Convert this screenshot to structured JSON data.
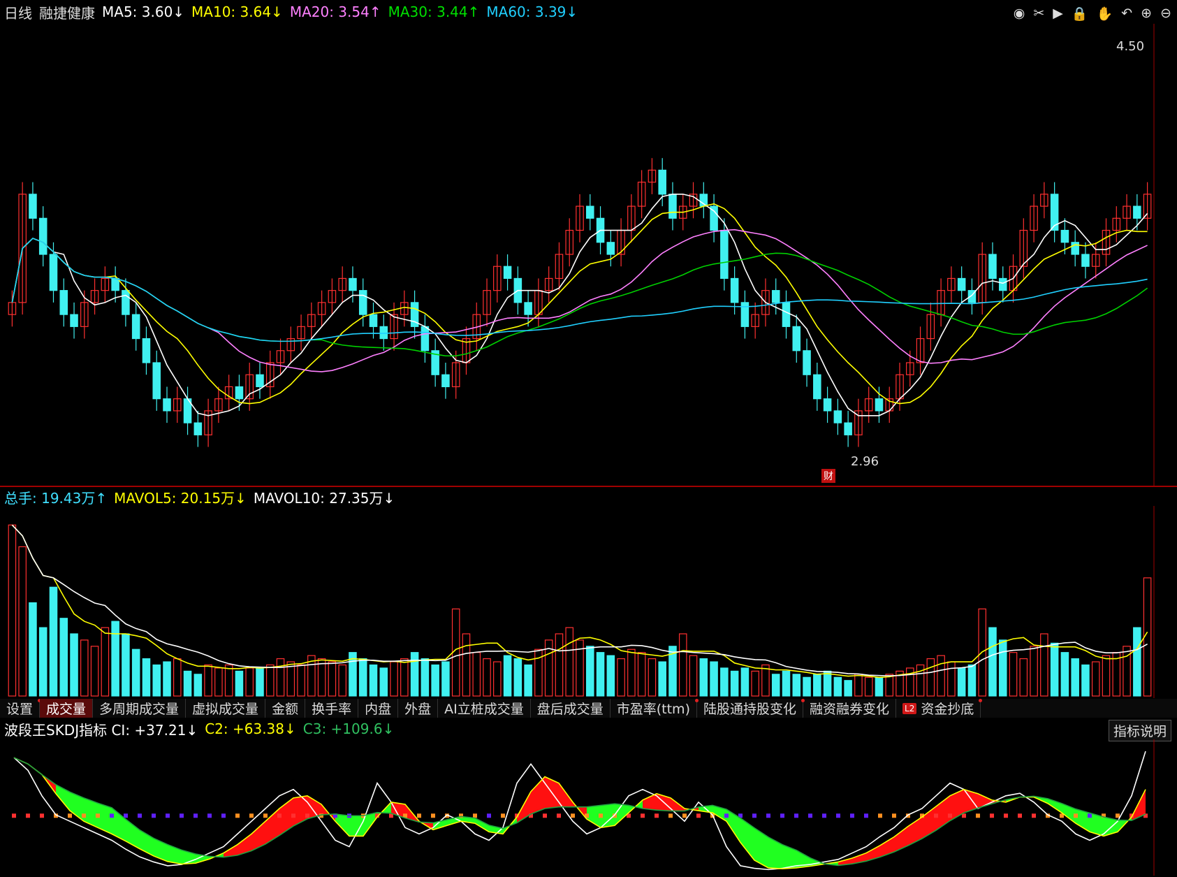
{
  "header": {
    "period": "日线",
    "name": "融捷健康",
    "ma": [
      {
        "label": "MA5: 3.60",
        "arrow": "↓",
        "color": "#ffffff"
      },
      {
        "label": "MA10: 3.64",
        "arrow": "↓",
        "color": "#ffff00"
      },
      {
        "label": "MA20: 3.54",
        "arrow": "↑",
        "color": "#ff80ff"
      },
      {
        "label": "MA30: 3.44",
        "arrow": "↑",
        "color": "#00e000"
      },
      {
        "label": "MA60: 3.39",
        "arrow": "↓",
        "color": "#20d0ff"
      }
    ]
  },
  "toolbar_icons": [
    "eye-icon",
    "scissors-icon",
    "play-icon",
    "lock-icon",
    "hand-icon",
    "undo-icon",
    "zoom-in-icon",
    "zoom-out-icon"
  ],
  "volume_header": [
    {
      "label": "总手: 19.43万",
      "arrow": "↑",
      "color": "#40e0ff"
    },
    {
      "label": "MAVOL5: 20.15万",
      "arrow": "↓",
      "color": "#ffff00"
    },
    {
      "label": "MAVOL10: 27.35万",
      "arrow": "↓",
      "color": "#ffffff"
    }
  ],
  "tabs": [
    {
      "label": "设置",
      "active": false,
      "dot": true
    },
    {
      "label": "成交量",
      "active": true,
      "dot": false
    },
    {
      "label": "多周期成交量",
      "active": false,
      "dot": false
    },
    {
      "label": "虚拟成交量",
      "active": false,
      "dot": false
    },
    {
      "label": "金额",
      "active": false,
      "dot": false
    },
    {
      "label": "换手率",
      "active": false,
      "dot": false
    },
    {
      "label": "内盘",
      "active": false,
      "dot": false
    },
    {
      "label": "外盘",
      "active": false,
      "dot": false
    },
    {
      "label": "AI立桩成交量",
      "active": false,
      "dot": false
    },
    {
      "label": "盘后成交量",
      "active": false,
      "dot": false
    },
    {
      "label": "市盈率(ttm)",
      "active": false,
      "dot": true
    },
    {
      "label": "陆股通持股变化",
      "active": false,
      "dot": true
    },
    {
      "label": "融资融券变化",
      "active": false,
      "dot": false
    },
    {
      "label": "资金抄底",
      "active": false,
      "dot": true,
      "badge": "L2"
    }
  ],
  "indicator_header": [
    {
      "label": "波段王SKDJ指标 CI: +37.21",
      "arrow": "↓",
      "color": "#ffffff"
    },
    {
      "label": "C2: +63.38",
      "arrow": "↓",
      "color": "#ffff00"
    },
    {
      "label": "C3: +109.6",
      "arrow": "↓",
      "color": "#30c060"
    }
  ],
  "explain_button": "指标说明",
  "price_marks": {
    "high_label": "4.50",
    "low_label": "2.96",
    "event_badge": "财"
  },
  "colors": {
    "up": "#ff3030",
    "down": "#40f0f0",
    "ma5": "#ffffff",
    "ma10": "#ffff00",
    "ma20": "#ff80ff",
    "ma30": "#00d000",
    "ma60": "#20d0ff"
  },
  "chart_data": {
    "type": "candlestick",
    "price_range": [
      2.8,
      4.6
    ],
    "closes": [
      3.5,
      3.95,
      3.85,
      3.7,
      3.55,
      3.45,
      3.4,
      3.5,
      3.55,
      3.6,
      3.55,
      3.45,
      3.35,
      3.25,
      3.1,
      3.05,
      3.1,
      3.0,
      2.95,
      3.05,
      3.1,
      3.15,
      3.1,
      3.2,
      3.15,
      3.25,
      3.3,
      3.35,
      3.4,
      3.45,
      3.5,
      3.55,
      3.6,
      3.55,
      3.45,
      3.4,
      3.35,
      3.45,
      3.5,
      3.4,
      3.3,
      3.2,
      3.15,
      3.25,
      3.35,
      3.45,
      3.55,
      3.65,
      3.6,
      3.5,
      3.45,
      3.55,
      3.6,
      3.7,
      3.8,
      3.9,
      3.85,
      3.75,
      3.7,
      3.8,
      3.9,
      4.0,
      4.05,
      3.95,
      3.85,
      3.9,
      3.95,
      3.9,
      3.8,
      3.6,
      3.5,
      3.4,
      3.45,
      3.55,
      3.5,
      3.4,
      3.3,
      3.2,
      3.1,
      3.05,
      3.0,
      2.95,
      3.05,
      3.1,
      3.05,
      3.1,
      3.2,
      3.25,
      3.35,
      3.45,
      3.55,
      3.6,
      3.55,
      3.5,
      3.7,
      3.6,
      3.55,
      3.65,
      3.8,
      3.9,
      3.95,
      3.8,
      3.75,
      3.7,
      3.65,
      3.7,
      3.8,
      3.85,
      3.9,
      3.85,
      3.95
    ],
    "volume_range": [
      0,
      60
    ],
    "volumes": [
      55,
      48,
      30,
      22,
      35,
      25,
      20,
      18,
      16,
      22,
      24,
      20,
      15,
      12,
      10,
      11,
      12,
      8,
      7,
      10,
      9,
      10,
      8,
      9,
      9,
      10,
      12,
      11,
      10,
      13,
      12,
      11,
      10,
      14,
      12,
      10,
      9,
      11,
      12,
      14,
      12,
      10,
      11,
      28,
      20,
      14,
      12,
      11,
      13,
      12,
      10,
      15,
      18,
      20,
      22,
      18,
      16,
      14,
      13,
      12,
      15,
      14,
      12,
      11,
      16,
      20,
      13,
      12,
      11,
      9,
      8,
      9,
      8,
      10,
      7,
      8,
      7,
      6,
      7,
      8,
      6,
      5,
      7,
      6,
      6,
      7,
      8,
      9,
      10,
      12,
      13,
      11,
      9,
      10,
      28,
      22,
      18,
      14,
      12,
      16,
      20,
      17,
      14,
      12,
      10,
      11,
      13,
      14,
      16,
      22,
      38
    ],
    "indicator_range": [
      0,
      100
    ],
    "ci": [
      90,
      80,
      60,
      45,
      40,
      35,
      30,
      25,
      18,
      12,
      8,
      5,
      6,
      10,
      15,
      20,
      30,
      40,
      50,
      60,
      65,
      55,
      40,
      25,
      20,
      40,
      70,
      55,
      35,
      30,
      35,
      45,
      40,
      30,
      25,
      35,
      70,
      85,
      70,
      55,
      40,
      30,
      35,
      45,
      60,
      65,
      60,
      50,
      40,
      55,
      45,
      20,
      5,
      3,
      2,
      3,
      5,
      6,
      8,
      10,
      15,
      20,
      28,
      35,
      45,
      50,
      60,
      70,
      65,
      50,
      55,
      60,
      62,
      55,
      45,
      40,
      30,
      25,
      30,
      40,
      60,
      95
    ]
  }
}
